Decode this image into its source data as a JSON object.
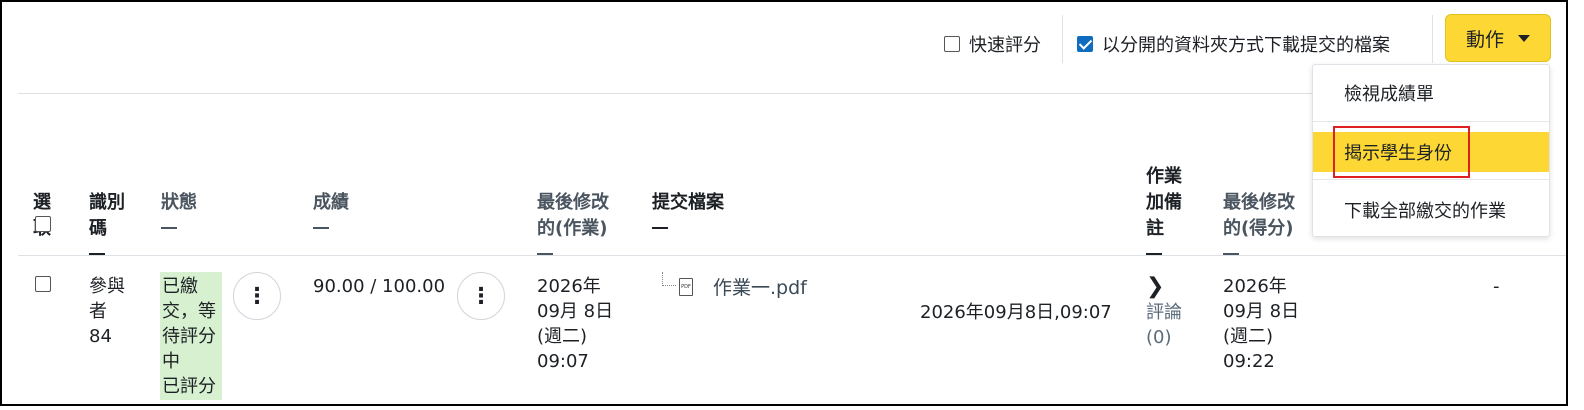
{
  "toolbar": {
    "quick_grading_label": "快速評分",
    "quick_grading_checked": false,
    "download_folders_label": "以分開的資料夾方式下載提交的檔案",
    "download_folders_checked": true,
    "action_label": "動作"
  },
  "action_menu": {
    "items": [
      {
        "label": "檢視成績單"
      },
      {
        "label": "揭示學生身份"
      },
      {
        "label": "下載全部繳交的作業"
      }
    ],
    "active_index": 1
  },
  "table": {
    "headers": {
      "select": "選\n取",
      "id": "識別\n碼",
      "status": "狀態",
      "grade": "成績",
      "last_modified_submission": "最後修改\n的(作業)",
      "files": "提交檔案",
      "comments": "作業\n加備\n註",
      "last_modified_grade": "最後修改\n的(得分)"
    },
    "rows": [
      {
        "participant": "參與\n者\n84",
        "status": "已繳\n交，等\n待評分\n中\n已評分",
        "grade": "90.00 / 100.00",
        "last_modified_submission": "2026年\n09月 8日\n(週二)\n09:07",
        "file_name": "作業一.pdf",
        "file_icon": "pdf-file-icon",
        "file_timestamp": "2026年09月8日,09:07",
        "comments_toggle_icon": "chevron-right-icon",
        "comments_label": "評論\n(0)",
        "last_modified_grade": "2026年\n09月 8日\n(週二)\n09:22",
        "final_grade": "-"
      }
    ]
  },
  "colors": {
    "accent_yellow": "#fdd835",
    "status_green": "#d7f0d0",
    "highlight_red": "#e02020",
    "checkbox_blue": "#0f6cbf"
  }
}
